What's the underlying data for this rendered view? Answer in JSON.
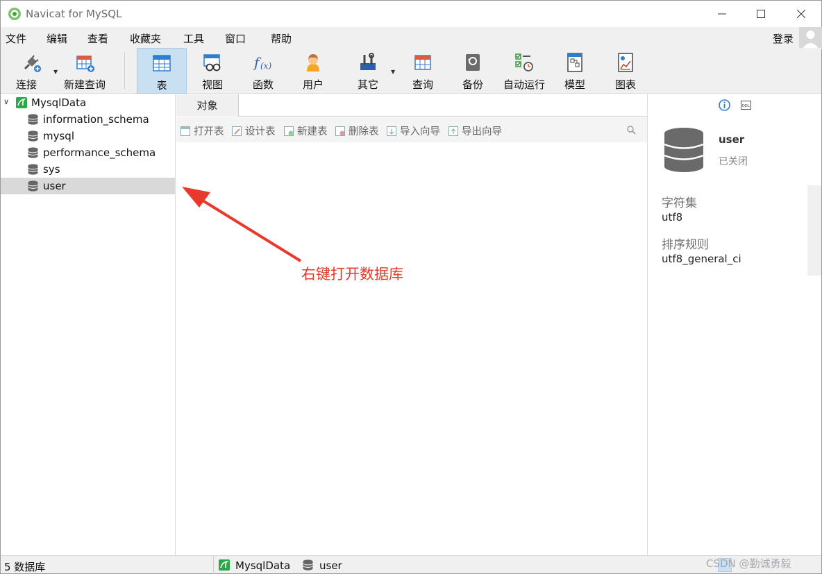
{
  "window": {
    "title": "Navicat for MySQL"
  },
  "menu": [
    "文件",
    "编辑",
    "查看",
    "收藏夹",
    "工具",
    "窗口",
    "帮助"
  ],
  "login_label": "登录",
  "toolbar": {
    "connect": "连接",
    "new_query": "新建查询",
    "items": [
      "表",
      "视图",
      "函数",
      "用户",
      "其它",
      "查询",
      "备份",
      "自动运行",
      "模型",
      "图表"
    ],
    "active": "表"
  },
  "nav": {
    "connection": "MysqlData",
    "databases": [
      "information_schema",
      "mysql",
      "performance_schema",
      "sys",
      "user"
    ],
    "selected": "user"
  },
  "objects": {
    "tab": "对象",
    "tools": [
      "打开表",
      "设计表",
      "新建表",
      "删除表",
      "导入向导",
      "导出向导"
    ]
  },
  "info": {
    "db_name": "user",
    "status": "已关闭",
    "charset_label": "字符集",
    "charset": "utf8",
    "collation_label": "排序规则",
    "collation": "utf8_general_ci"
  },
  "statusbar": {
    "count": "5 数据库",
    "connection": "MysqlData",
    "database": "user",
    "watermark": "CSDN @勤诚勇毅"
  },
  "annotation": {
    "text": "右键打开数据库",
    "color": "#e8392b"
  },
  "colors": {
    "accent": "#c9dff2",
    "selection": "#d9d9d9",
    "annotation": "#e8392b"
  }
}
